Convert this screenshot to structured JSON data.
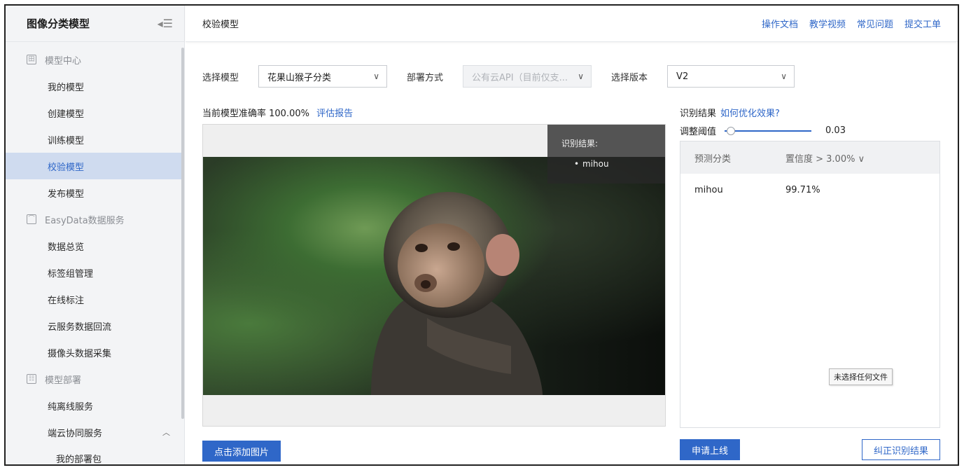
{
  "sidebar": {
    "title": "图像分类模型",
    "groups": [
      {
        "label": "模型中心",
        "icon": "building-icon",
        "items": [
          "我的模型",
          "创建模型",
          "训练模型",
          "校验模型",
          "发布模型"
        ]
      },
      {
        "label": "EasyData数据服务",
        "icon": "chart-icon",
        "items": [
          "数据总览",
          "标签组管理",
          "在线标注",
          "云服务数据回流",
          "摄像头数据采集"
        ]
      },
      {
        "label": "模型部署",
        "icon": "deploy-icon",
        "items": [
          "纯离线服务",
          "端云协同服务"
        ],
        "sub_items": [
          "我的部署包"
        ]
      }
    ],
    "active_item": "校验模型"
  },
  "header": {
    "title": "校验模型",
    "links": [
      "操作文档",
      "教学视频",
      "常见问题",
      "提交工单"
    ]
  },
  "form": {
    "model_label": "选择模型",
    "model_value": "花果山猴子分类",
    "deploy_label": "部署方式",
    "deploy_value": "公有云API（目前仅支...",
    "version_label": "选择版本",
    "version_value": "V2"
  },
  "accuracy": {
    "text": "当前模型准确率 100.00%",
    "report_link": "评估报告"
  },
  "overlay": {
    "title": "识别结果:",
    "item": "mihou"
  },
  "add_image_button": "点击添加图片",
  "results": {
    "title": "识别结果",
    "optimize_link": "如何优化效果?",
    "threshold_label": "调整阈值",
    "threshold_value": "0.03",
    "threshold_fraction": 0.03,
    "col_category": "预测分类",
    "col_confidence": "置信度 > 3.00%",
    "rows": [
      {
        "category": "mihou",
        "confidence": "99.71%"
      }
    ],
    "tooltip": "未选择任何文件"
  },
  "apply_button": "申请上线",
  "correct_button": "纠正识别结果",
  "colors": {
    "accent": "#2f67c8",
    "active_bg": "#cfdbef"
  }
}
